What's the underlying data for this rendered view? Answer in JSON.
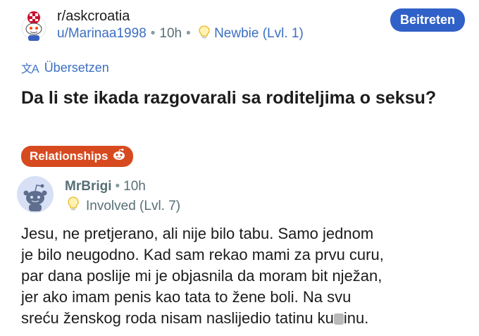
{
  "post": {
    "subreddit": "r/askcroatia",
    "author": "u/Marinaa1998",
    "time": "10h",
    "author_flair": "Newbie (Lvl. 1)",
    "join_label": "Beitreten",
    "translate_label": "Übersetzen",
    "title": "Da li ste ikada razgovarali sa roditeljima o seksu?",
    "flair": "Relationships"
  },
  "comment": {
    "author": "MrBrigi",
    "time": "10h",
    "author_flair": "Involved (Lvl. 7)",
    "body_lines": [
      "Jesu, ne pretjerano, ali nije bilo tabu. Samo jednom",
      "je bilo neugodno. Kad sam rekao mami za prvu curu,",
      "par dana poslije mi je objasnila da moram bit nježan,",
      "jer ako imam penis kao tata to žene boli. Na svu",
      "sreću ženskog roda nisam naslijedio tatinu ku",
      "inu."
    ]
  },
  "colors": {
    "link_blue": "#3b6fc2",
    "join_button": "#3061c8",
    "flair_bg": "#d74a1f",
    "meta_gray": "#576f76"
  },
  "icons": {
    "subreddit_avatar": "subreddit-avatar-icon",
    "bulb": "lightbulb-icon",
    "translate": "translate-icon",
    "flair_emoji": "snoo-face-icon",
    "comment_avatar": "snoo-avatar-icon"
  }
}
